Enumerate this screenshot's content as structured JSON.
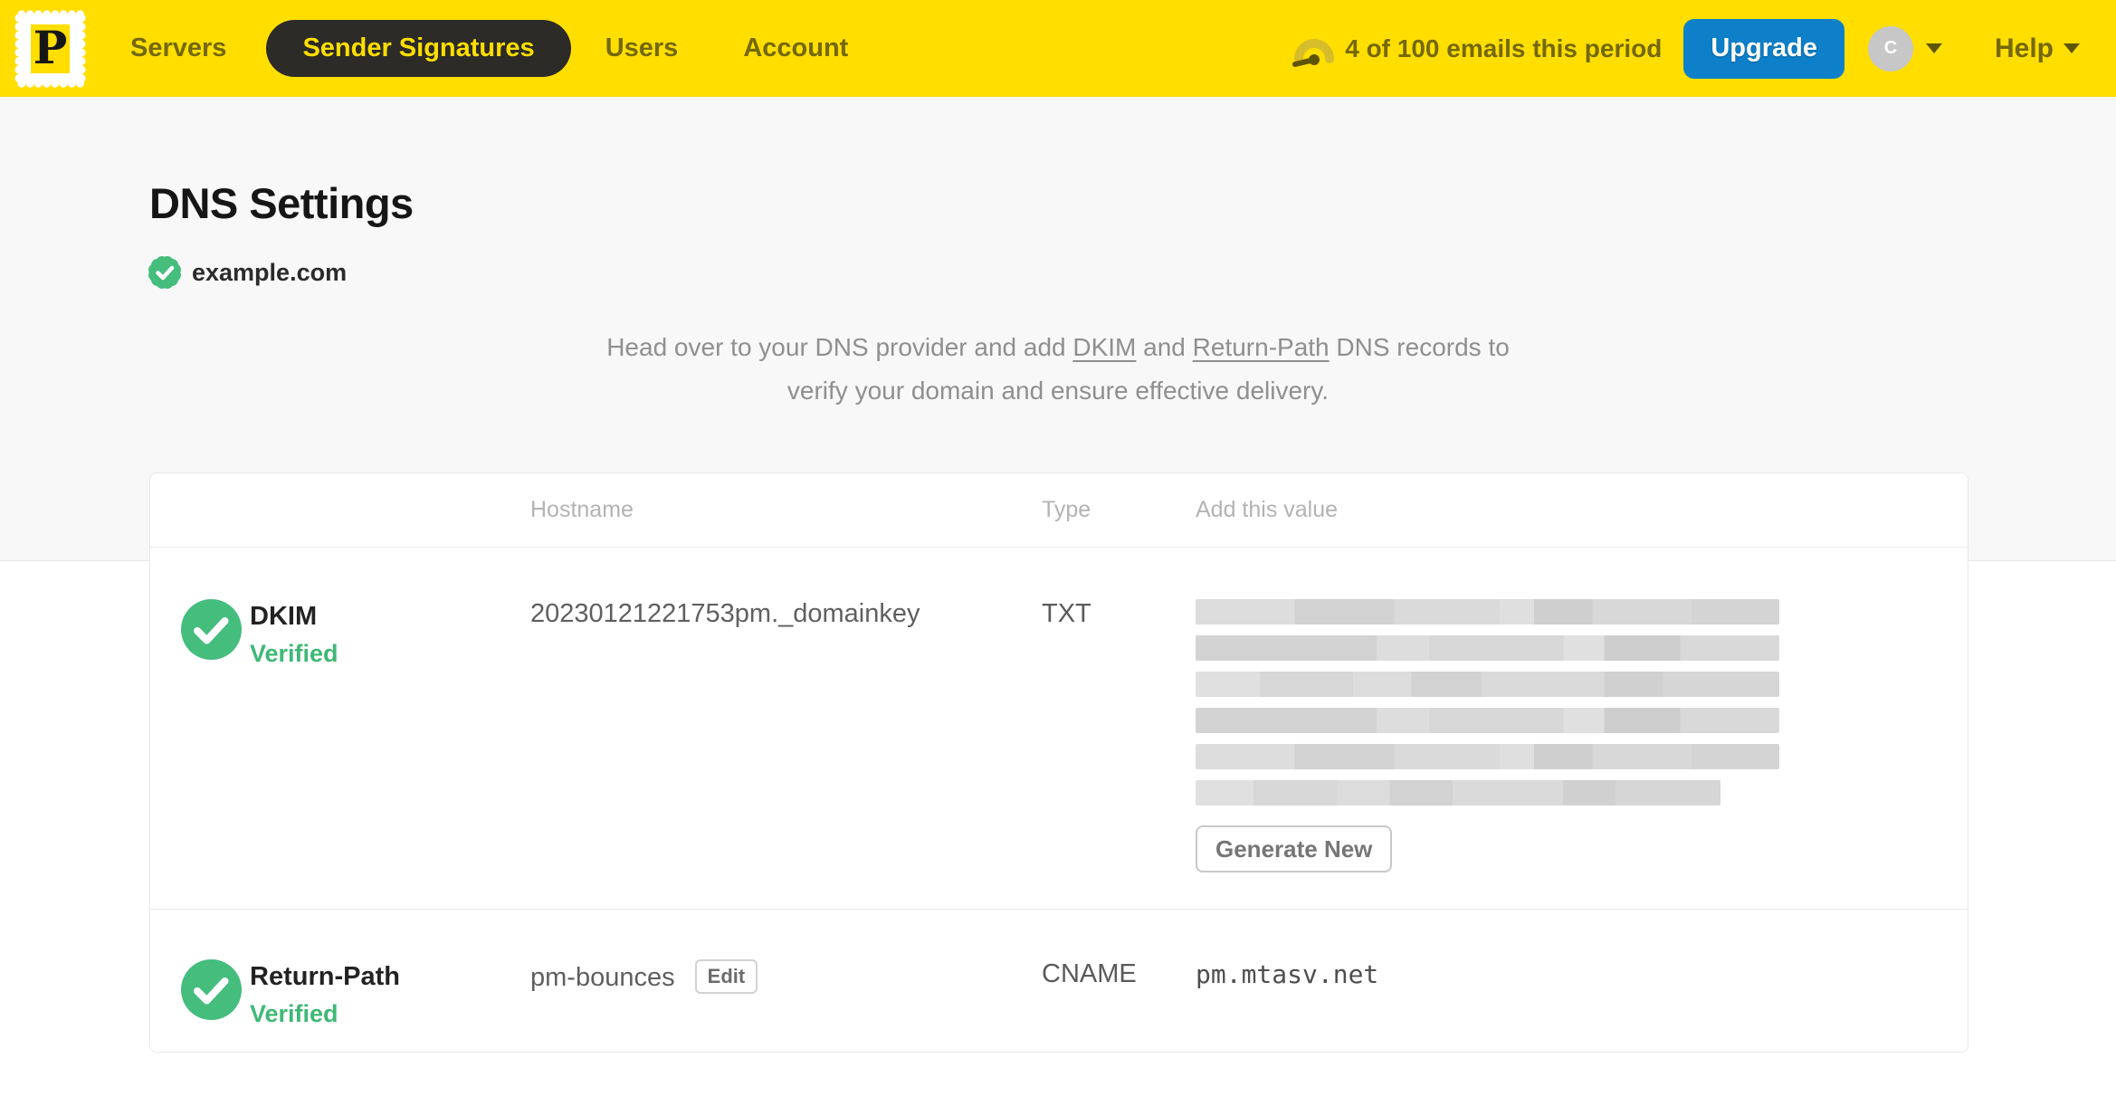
{
  "navbar": {
    "logo_letter": "P",
    "items": [
      {
        "label": "Servers",
        "active": false
      },
      {
        "label": "Sender Signatures",
        "active": true
      },
      {
        "label": "Users",
        "active": false
      },
      {
        "label": "Account",
        "active": false
      }
    ],
    "usage_text": "4 of 100 emails this period",
    "upgrade_label": "Upgrade",
    "avatar_initial": "C",
    "help_label": "Help"
  },
  "page": {
    "title": "DNS Settings",
    "domain": "example.com",
    "intro": {
      "part1": "Head over to your DNS provider and add ",
      "link_dkim": "DKIM",
      "part2": " and ",
      "link_return_path": "Return-Path",
      "part3": " DNS records to",
      "part4": "verify your domain and ensure effective delivery."
    }
  },
  "table": {
    "headers": {
      "hostname": "Hostname",
      "type": "Type",
      "value": "Add this value"
    },
    "rows": {
      "dkim": {
        "name": "DKIM",
        "status": "Verified",
        "hostname": "20230121221753pm._domainkey",
        "type": "TXT",
        "value_redacted": true,
        "action_label": "Generate New"
      },
      "return_path": {
        "name": "Return-Path",
        "status": "Verified",
        "hostname": "pm-bounces",
        "edit_label": "Edit",
        "type": "CNAME",
        "value": "pm.mtasv.net"
      }
    }
  },
  "colors": {
    "brand_yellow": "#ffde00",
    "nav_text_olive": "#746809",
    "active_pill_bg": "#2c2b28",
    "upgrade_blue": "#0e80c9",
    "success_green": "#45bd7d",
    "verified_text_green": "#3fb876"
  }
}
